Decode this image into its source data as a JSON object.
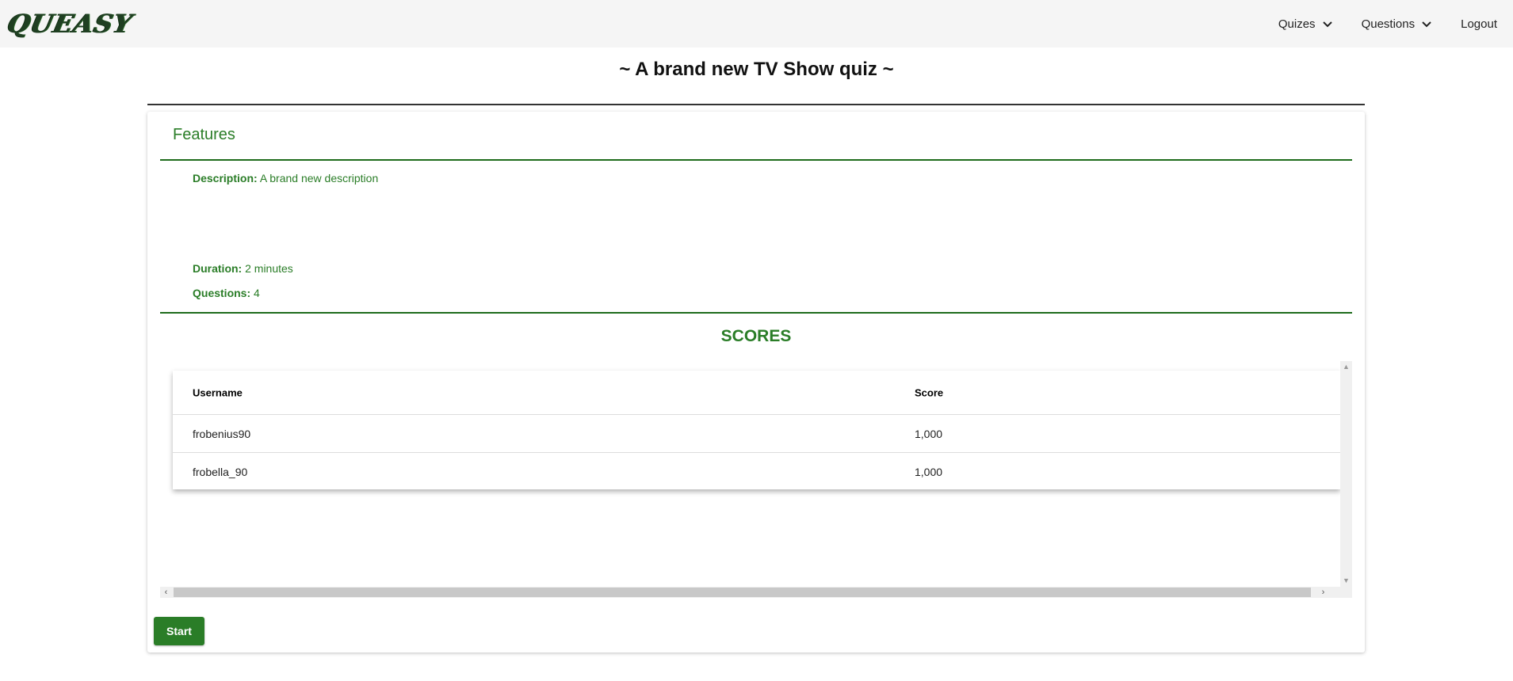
{
  "app": {
    "logo_text": "QUEASY"
  },
  "nav": {
    "quizes_label": "Quizes",
    "questions_label": "Questions",
    "logout_label": "Logout"
  },
  "page": {
    "title": "~ A brand new TV Show quiz ~"
  },
  "features": {
    "heading": "Features",
    "description_label": "Description:",
    "description_value": "A brand new description",
    "duration_label": "Duration:",
    "duration_value": "2 minutes",
    "questions_label": "Questions:",
    "questions_value": "4"
  },
  "scores": {
    "heading": "SCORES",
    "columns": [
      "Username",
      "Score"
    ],
    "rows": [
      {
        "username": "frobenius90",
        "score": "1,000"
      },
      {
        "username": "frobella_90",
        "score": "1,000"
      }
    ]
  },
  "actions": {
    "start_label": "Start"
  },
  "colors": {
    "accent_green": "#2a7d27",
    "navbar_bg": "#f5f5f5"
  }
}
